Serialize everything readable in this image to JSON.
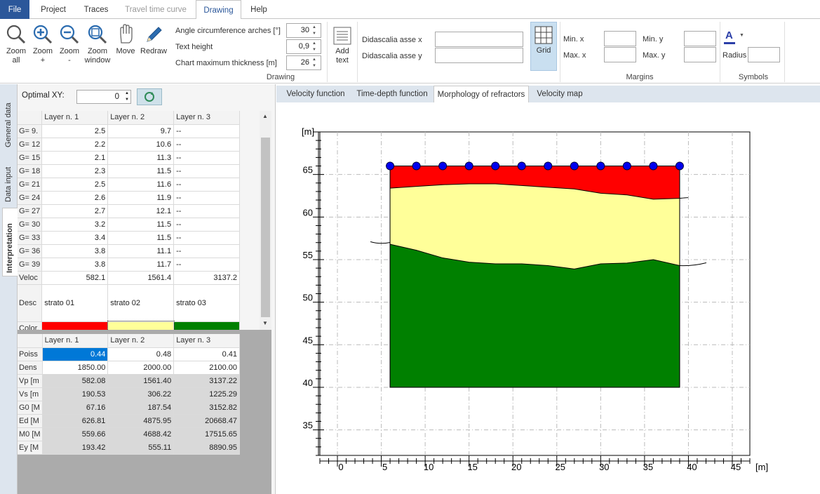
{
  "menu": {
    "tabs": [
      "File",
      "Project",
      "Traces",
      "Travel time curve",
      "Drawing",
      "Help"
    ]
  },
  "ribbon": {
    "buttons": {
      "zoom_all": "Zoom\nall",
      "zoom_plus": "Zoom\n+",
      "zoom_minus": "Zoom\n-",
      "zoom_window": "Zoom\nwindow",
      "move": "Move",
      "redraw": "Redraw",
      "add_text": "Add\ntext",
      "grid": "Grid"
    },
    "drawing": {
      "angle_label": "Angle circumference arches [°]",
      "angle_value": "30",
      "text_height_label": "Text height",
      "text_height_value": "0,9",
      "max_thickness_label": "Chart maximum thickness [m]",
      "max_thickness_value": "26",
      "group": "Drawing"
    },
    "captions": {
      "x_label": "Didascalia asse x",
      "y_label": "Didascalia asse y"
    },
    "margins": {
      "min_x": "Min. x",
      "max_x": "Max. x",
      "min_y": "Min. y",
      "max_y": "Max. y",
      "group": "Margins"
    },
    "symbols": {
      "font_icon_letter": "A",
      "radius": "Radius",
      "group": "Symbols"
    }
  },
  "sidebar_tabs": [
    "General data",
    "Data input",
    "Interpretation"
  ],
  "left": {
    "optimal_label": "Optimal XY:",
    "optimal_value": "0",
    "grid1": {
      "headers": [
        "Layer n. 1",
        "Layer n. 2",
        "Layer n. 3"
      ],
      "rows": [
        [
          "G= 9.",
          "2.5",
          "9.7",
          "--"
        ],
        [
          "G= 12",
          "2.2",
          "10.6",
          "--"
        ],
        [
          "G= 15",
          "2.1",
          "11.3",
          "--"
        ],
        [
          "G= 18",
          "2.3",
          "11.5",
          "--"
        ],
        [
          "G= 21",
          "2.5",
          "11.6",
          "--"
        ],
        [
          "G= 24",
          "2.6",
          "11.9",
          "--"
        ],
        [
          "G= 27",
          "2.7",
          "12.1",
          "--"
        ],
        [
          "G= 30",
          "3.2",
          "11.5",
          "--"
        ],
        [
          "G= 33",
          "3.4",
          "11.5",
          "--"
        ],
        [
          "G= 36",
          "3.8",
          "11.1",
          "--"
        ],
        [
          "G= 39",
          "3.8",
          "11.7",
          "--"
        ],
        [
          "Veloc",
          "582.1",
          "1561.4",
          "3137.2"
        ]
      ],
      "desc_label": "Desc",
      "descriptions": [
        "strato 01",
        "strato 02",
        "strato 03"
      ],
      "color_label": "Color.",
      "colors": [
        "#ff0000",
        "#ffff99",
        "#008000"
      ]
    },
    "grid2": {
      "headers": [
        "Layer n. 1",
        "Layer n. 2",
        "Layer n. 3"
      ],
      "rows": [
        [
          "Poiss",
          "0.44",
          "0.48",
          "0.41"
        ],
        [
          "Dens",
          "1850.00",
          "2000.00",
          "2100.00"
        ],
        [
          "Vp [m",
          "582.08",
          "1561.40",
          "3137.22"
        ],
        [
          "Vs [m",
          "190.53",
          "306.22",
          "1225.29"
        ],
        [
          "G0 [M",
          "67.16",
          "187.54",
          "3152.82"
        ],
        [
          "Ed [M",
          "626.81",
          "4875.95",
          "20668.47"
        ],
        [
          "M0 [M",
          "559.66",
          "4688.42",
          "17515.65"
        ],
        [
          "Ey [M",
          "193.42",
          "555.11",
          "8890.95"
        ]
      ]
    }
  },
  "right_tabs": [
    "Velocity function",
    "Time-depth function",
    "Morphology of refractors",
    "Velocity map"
  ],
  "chart_data": {
    "type": "area",
    "xlabel": "[m]",
    "ylabel": "[m]",
    "xlim": [
      -2,
      47
    ],
    "ylim": [
      32,
      70
    ],
    "xticks": [
      0,
      5,
      10,
      15,
      20,
      25,
      30,
      35,
      40,
      45
    ],
    "yticks": [
      35,
      40,
      45,
      50,
      55,
      60,
      65
    ],
    "grid": true,
    "bottom": 40,
    "x_range": [
      6,
      39
    ],
    "top_surface": 66,
    "geophones_x": [
      6,
      9,
      12,
      15,
      18,
      21,
      24,
      27,
      30,
      33,
      36,
      39
    ],
    "layers": [
      {
        "name": "strato 01",
        "color": "#ff0000",
        "base": [
          [
            6,
            63.4
          ],
          [
            9,
            63.6
          ],
          [
            12,
            63.8
          ],
          [
            15,
            63.9
          ],
          [
            18,
            63.9
          ],
          [
            21,
            63.7
          ],
          [
            24,
            63.5
          ],
          [
            27,
            63.3
          ],
          [
            30,
            62.8
          ],
          [
            33,
            62.6
          ],
          [
            36,
            62.1
          ],
          [
            39,
            62.2
          ]
        ]
      },
      {
        "name": "strato 02",
        "color": "#ffff99",
        "base": [
          [
            6,
            56.8
          ],
          [
            9,
            56.1
          ],
          [
            12,
            55.2
          ],
          [
            15,
            54.7
          ],
          [
            18,
            54.5
          ],
          [
            21,
            54.5
          ],
          [
            24,
            54.3
          ],
          [
            27,
            53.9
          ],
          [
            30,
            54.5
          ],
          [
            33,
            54.6
          ],
          [
            36,
            55.0
          ],
          [
            39,
            54.3
          ]
        ]
      },
      {
        "name": "strato 03",
        "color": "#008000"
      }
    ]
  }
}
